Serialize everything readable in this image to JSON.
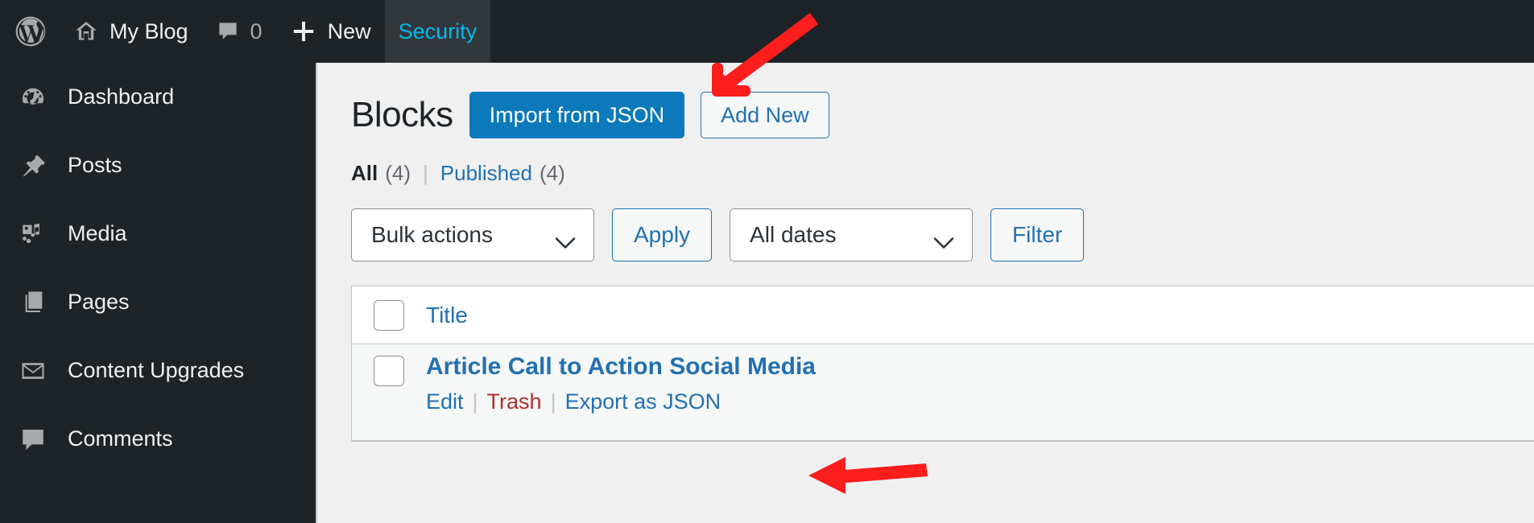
{
  "adminbar": {
    "wp_logo_icon": "wordpress-logo-icon",
    "site": {
      "icon": "home-icon",
      "label": "My Blog"
    },
    "comments": {
      "icon": "comment-bubble-icon",
      "count": "0"
    },
    "new": {
      "icon": "plus-icon",
      "label": "New"
    },
    "security": {
      "label": "Security"
    }
  },
  "sidebar": {
    "items": [
      {
        "icon": "dashboard-gauge-icon",
        "label": "Dashboard"
      },
      {
        "icon": "pushpin-icon",
        "label": "Posts"
      },
      {
        "icon": "media-camera-music-icon",
        "label": "Media"
      },
      {
        "icon": "pages-stack-icon",
        "label": "Pages"
      },
      {
        "icon": "envelope-icon",
        "label": "Content Upgrades"
      },
      {
        "icon": "comment-bubble-icon",
        "label": "Comments"
      }
    ]
  },
  "page": {
    "title": "Blocks",
    "import_button": "Import from JSON",
    "add_new_button": "Add New"
  },
  "views": {
    "all_label": "All",
    "all_count": "(4)",
    "separator": "|",
    "published_label": "Published",
    "published_count": "(4)"
  },
  "tablenav": {
    "bulk_actions": "Bulk actions",
    "apply": "Apply",
    "all_dates": "All dates",
    "filter": "Filter",
    "chevron_icon": "chevron-down-icon"
  },
  "table": {
    "columns": [
      "Title"
    ],
    "rows": [
      {
        "title": "Article Call to Action Social Media",
        "actions": [
          {
            "label": "Edit",
            "kind": "link"
          },
          {
            "label": "Trash",
            "kind": "danger"
          },
          {
            "label": "Export as JSON",
            "kind": "link"
          }
        ]
      }
    ]
  },
  "annotations": {
    "arrow_import": "red-arrow-pointing-down-left-to-import-from-json",
    "arrow_export": "red-arrow-pointing-left-to-export-as-json",
    "color": "#fc1d1d"
  },
  "colors": {
    "admin_bg": "#1d2327",
    "accent_blue": "#2271b1",
    "primary_button": "#0b79ba",
    "active_tab_text": "#00b9eb",
    "danger_red": "#b32d2e"
  }
}
